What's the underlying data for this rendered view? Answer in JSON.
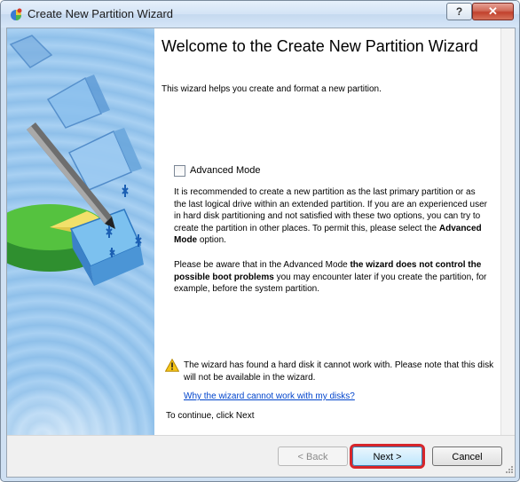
{
  "window": {
    "title": "Create New Partition Wizard",
    "help_label": "?",
    "close_label": "✕"
  },
  "page": {
    "heading": "Welcome to the Create New Partition Wizard",
    "intro": "This wizard helps you create and format a new partition.",
    "advanced_mode": {
      "label": "Advanced Mode",
      "checked": false
    },
    "paragraph1": {
      "text": "It is recommended to create a new partition as the last primary partition or as the last logical drive within an extended partition. If you are an experienced user in hard disk partitioning and not satisfied with these two options, you can try to create the partition in other places. To permit this, please select the ",
      "bold": "Advanced Mode",
      "tail": " option."
    },
    "paragraph2": {
      "text": "Please be aware that in the Advanced Mode ",
      "bold": "the wizard does not control the possible boot problems",
      "tail": " you may encounter later if you create the partition, for example, before the system partition."
    },
    "warning": {
      "icon": "warning-icon",
      "text": "The wizard has found a hard disk it cannot work with. Please note that this disk will not be available in the wizard.",
      "link": "Why the wizard cannot work with my disks?"
    },
    "continue_text": "To continue, click Next"
  },
  "buttons": {
    "back": "< Back",
    "next": "Next >",
    "cancel": "Cancel"
  },
  "colors": {
    "highlight": "#d7262b",
    "link": "#0044cc"
  }
}
